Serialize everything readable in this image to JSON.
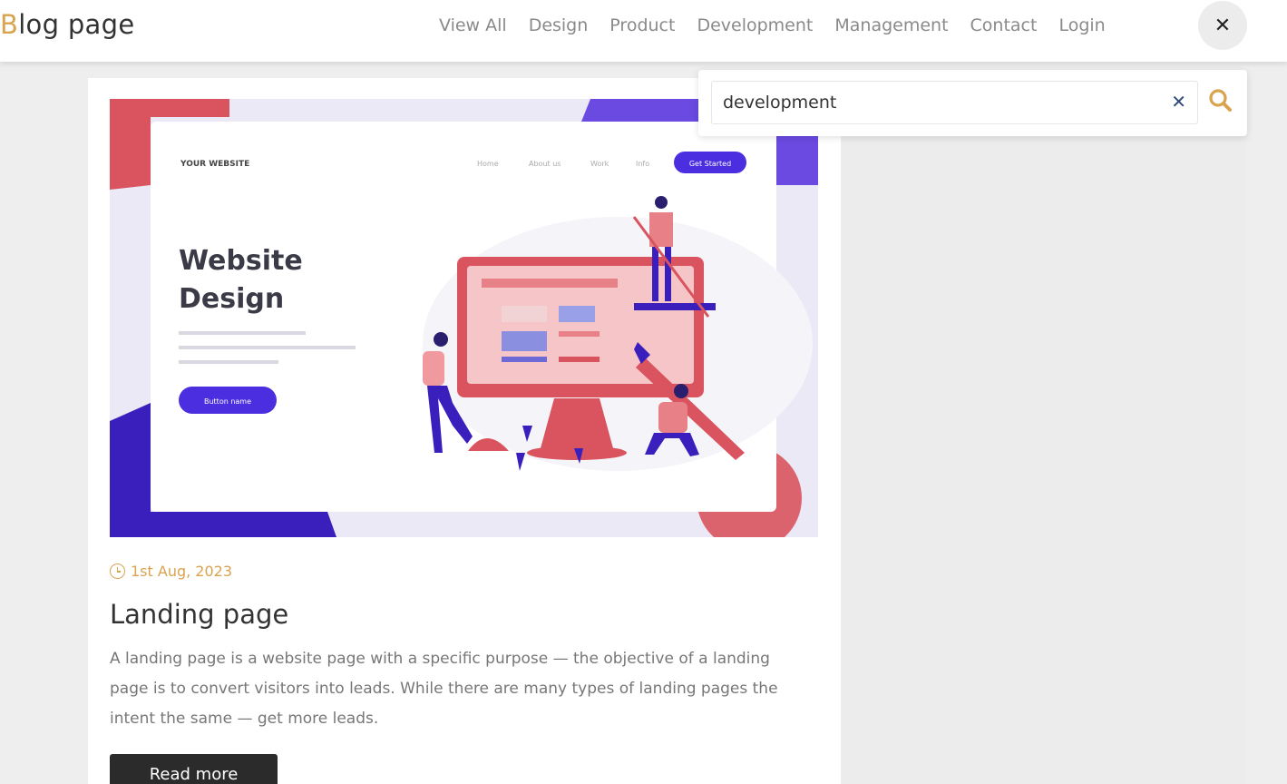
{
  "logo": {
    "first_letter": "B",
    "rest": "log page"
  },
  "nav": {
    "items": [
      {
        "label": "View All"
      },
      {
        "label": "Design"
      },
      {
        "label": "Product"
      },
      {
        "label": "Development"
      },
      {
        "label": "Management"
      },
      {
        "label": "Contact"
      },
      {
        "label": "Login"
      }
    ],
    "close_glyph": "✕"
  },
  "search": {
    "value": "development",
    "clear_glyph": "✕",
    "icon": "search-icon"
  },
  "post": {
    "date": "1st Aug, 2023",
    "title": "Landing page",
    "excerpt": "A landing page is a website page with a specific purpose — the objective of a landing page is to convert visitors into leads. While there are many types of landing pages the intent the same — get more leads.",
    "read_more": "Read more",
    "image": {
      "site_label": "YOUR WEBSITE",
      "menu": [
        "Home",
        "About us",
        "Work",
        "Info"
      ],
      "cta": "Get Started",
      "headline_line1": "Website",
      "headline_line2": "Design",
      "body_button": "Button name"
    }
  },
  "colors": {
    "accent": "#d9a34f",
    "dark_button": "#2b2b2b",
    "illustration_purple": "#4b2ee0",
    "illustration_red": "#d9545f"
  }
}
